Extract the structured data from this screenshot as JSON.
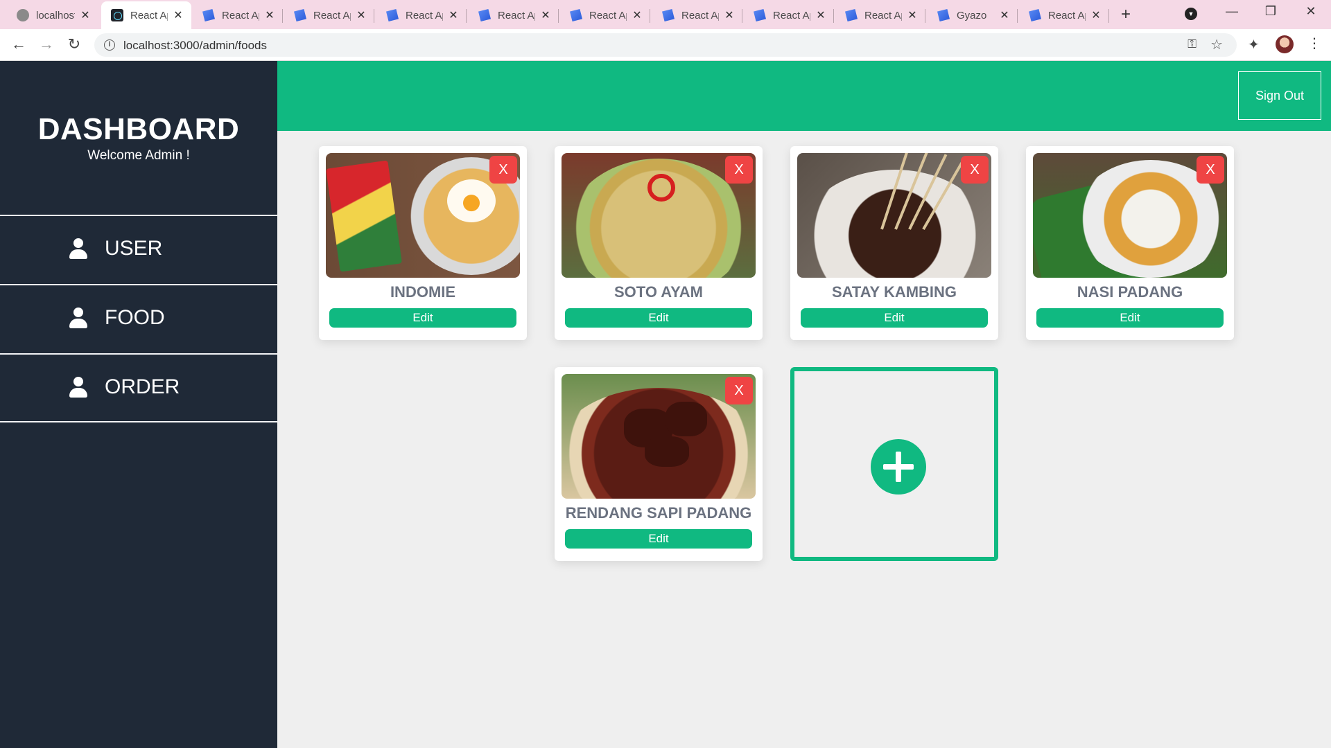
{
  "browser": {
    "tabs": [
      {
        "label": "localhost",
        "favicon": "globe-icon",
        "active": false
      },
      {
        "label": "React App",
        "favicon": "react-icon",
        "active": true
      },
      {
        "label": "React App",
        "favicon": "gyazo-icon",
        "active": false
      },
      {
        "label": "React App",
        "favicon": "gyazo-icon",
        "active": false
      },
      {
        "label": "React App",
        "favicon": "gyazo-icon",
        "active": false
      },
      {
        "label": "React App",
        "favicon": "gyazo-icon",
        "active": false
      },
      {
        "label": "React App",
        "favicon": "gyazo-icon",
        "active": false
      },
      {
        "label": "React App",
        "favicon": "gyazo-icon",
        "active": false
      },
      {
        "label": "React App",
        "favicon": "gyazo-icon",
        "active": false
      },
      {
        "label": "React App",
        "favicon": "gyazo-icon",
        "active": false
      },
      {
        "label": "Gyazo",
        "favicon": "gyazo-icon",
        "active": false
      },
      {
        "label": "React App",
        "favicon": "gyazo-icon",
        "active": false
      }
    ],
    "tab_close_glyph": "✕",
    "new_tab_glyph": "+",
    "url": "localhost:3000/admin/foods",
    "window_controls": {
      "minimize": "—",
      "restore": "❐",
      "close": "✕"
    }
  },
  "sidebar": {
    "title": "DASHBOARD",
    "subtitle": "Welcome Admin !",
    "items": [
      {
        "label": "USER",
        "icon": "user-icon"
      },
      {
        "label": "FOOD",
        "icon": "user-icon"
      },
      {
        "label": "ORDER",
        "icon": "user-icon"
      }
    ]
  },
  "header": {
    "sign_out": "Sign Out"
  },
  "foods": [
    {
      "name": "INDOMIE",
      "delete_label": "X",
      "edit_label": "Edit"
    },
    {
      "name": "SOTO AYAM",
      "delete_label": "X",
      "edit_label": "Edit"
    },
    {
      "name": "SATAY KAMBING",
      "delete_label": "X",
      "edit_label": "Edit"
    },
    {
      "name": "NASI PADANG",
      "delete_label": "X",
      "edit_label": "Edit"
    },
    {
      "name": "RENDANG SAPI PADANG",
      "delete_label": "X",
      "edit_label": "Edit"
    }
  ],
  "add_food": {
    "icon": "plus-circle-icon"
  },
  "colors": {
    "sidebar_bg": "#1f2937",
    "accent_green": "#10b981",
    "delete_red": "#ef4444",
    "page_bg": "#efefef",
    "card_title": "#6b7280"
  }
}
